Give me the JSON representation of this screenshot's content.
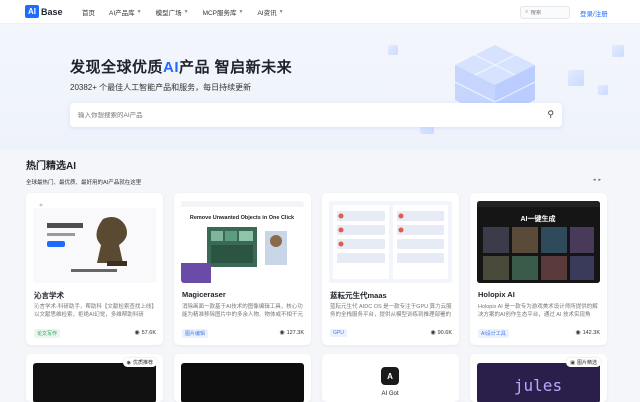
{
  "nav": {
    "logo_mark": "AI",
    "logo_text": "Base",
    "links": [
      {
        "label": "首页",
        "dropdown": false
      },
      {
        "label": "AI产品库",
        "dropdown": true
      },
      {
        "label": "模型广场",
        "dropdown": true
      },
      {
        "label": "MCP服务库",
        "dropdown": true
      },
      {
        "label": "AI资讯",
        "dropdown": true
      }
    ],
    "search_placeholder": "搜索",
    "login_label": "登录/注册"
  },
  "hero": {
    "title_part1": "发现全球优质",
    "title_ai": "AI",
    "title_part2": "产品 智启新未来",
    "subtitle": "20382+ 个最佳人工智能产品和服务，每日持续更新",
    "search_placeholder": "输入你想搜索的AI产品"
  },
  "section": {
    "title": "热门精选AI",
    "subtitle": "全球最热门、最优质、最好用的AI产品就在这里",
    "prev_icon": "chevron-left-icon",
    "next_icon": "chevron-right-icon"
  },
  "cards": [
    {
      "name": "沁言学术",
      "desc": "沁言学术-科研助手，帮助科【文献检索查找上线】以文献思维检索，拒绝AI幻觉，多维帮助科研",
      "tag": "论文写作",
      "views": "57.6K",
      "thumb_title": "沁言学术",
      "thumb_caption": "一个应用，科研全流程"
    },
    {
      "name": "Magiceraser",
      "desc": "消除画面一款基于AI技术的图像编辑工具，核心功能为精准移除图片中的多余人物、物体或不相干元素",
      "tag": "图片编辑",
      "views": "127.3K",
      "thumb_title": "Remove Unwanted Objects in One Click"
    },
    {
      "name": "蓝耘元生代maas",
      "desc": "蓝耘元生代 AIDC OS 是一款专注于GPU 算力云服务的全栈服务平台，提供从模型训练到推理部署的全流程服务",
      "tag": "GPU",
      "views": "90.6K"
    },
    {
      "name": "Holopix AI",
      "desc": "Holopix AI 是一款专为游戏美术设计师所提供的解决方案的AI创作生态平台，通过 AI 技术实现角色、场景",
      "tag": "AI设计工具",
      "views": "142.3K",
      "thumb_title": "AI一键生成"
    }
  ],
  "row2": [
    {
      "badge": "优质推荐",
      "badge_icon": "eye-icon"
    },
    {
      "badge": "",
      "badge_icon": ""
    },
    {
      "badge": "",
      "badge_icon": "",
      "thumb_title": "AI Got"
    },
    {
      "badge": "图片精选",
      "badge_icon": "image-icon",
      "thumb_title": "jules"
    }
  ]
}
